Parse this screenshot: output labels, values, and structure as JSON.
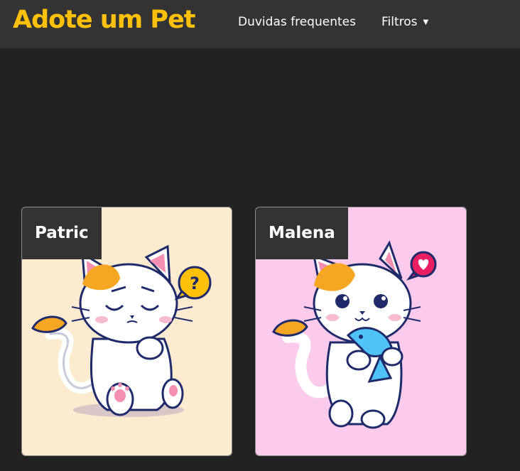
{
  "header": {
    "brand": "Adote um Pet",
    "nav": {
      "faq_label": "Duvidas frequentes",
      "filters_label": "Filtros"
    },
    "caret_icon": "caret-down-icon"
  },
  "pets": [
    {
      "name": "Patric",
      "bg_color": "#FDEBD0",
      "icon": "question-bubble-icon"
    },
    {
      "name": "Malena",
      "bg_color": "#FCCBEC",
      "icon": "heart-bubble-icon"
    }
  ],
  "colors": {
    "accent": "#FFC107",
    "page_bg": "#222222",
    "bar_bg": "#333333"
  }
}
